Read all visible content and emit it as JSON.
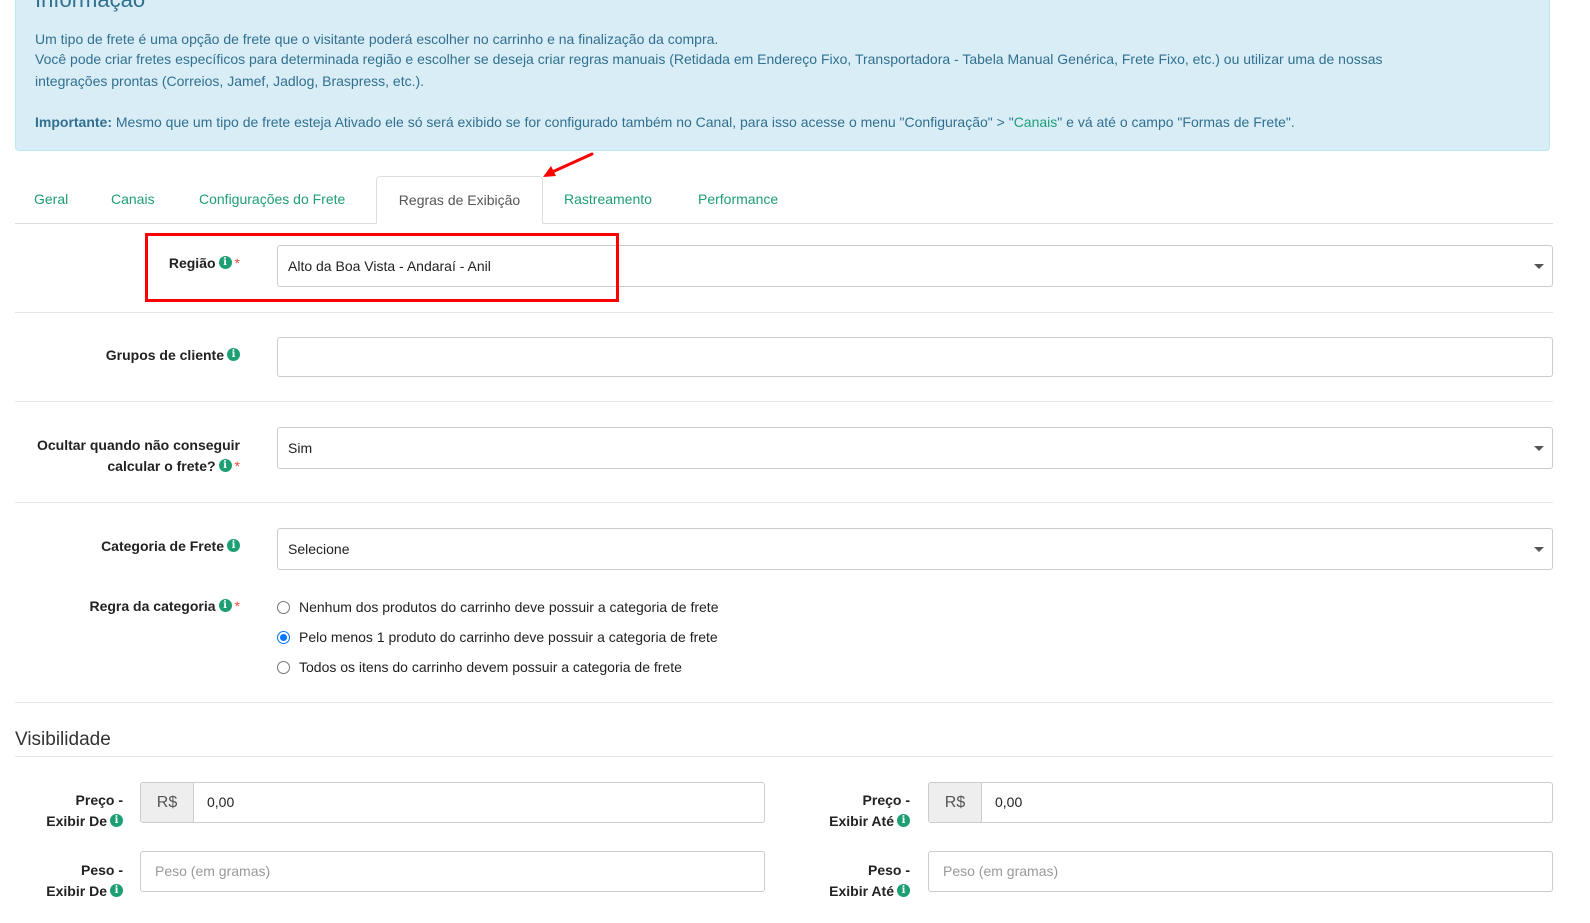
{
  "info": {
    "title": "Informação",
    "line1": "Um tipo de frete é uma opção de frete que o visitante poderá escolher no carrinho e na finalização da compra.",
    "line2": "Você pode criar fretes específicos para determinada região e escolher se deseja criar regras manuais (Retidada em Endereço Fixo, Transportadora - Tabela Manual Genérica, Frete Fixo, etc.) ou utilizar uma de nossas",
    "line3": "integrações prontas (Correios, Jamef, Jadlog, Braspress, etc.).",
    "important_label": "Importante:",
    "important_text_1": " Mesmo que um tipo de frete esteja Ativado ele só será exibido se for configurado também no Canal, para isso acesse o menu \"Configuração\" > \"",
    "important_link": "Canais",
    "important_text_2": "\" e vá até o campo \"Formas de Frete\"."
  },
  "tabs": [
    {
      "label": "Geral"
    },
    {
      "label": "Canais"
    },
    {
      "label": "Configurações do Frete"
    },
    {
      "label": "Regras de Exibição",
      "active": true
    },
    {
      "label": "Rastreamento"
    },
    {
      "label": "Performance"
    }
  ],
  "form": {
    "regiao": {
      "label": "Região",
      "value": "Alto da Boa Vista - Andaraí - Anil",
      "required": true
    },
    "grupos": {
      "label": "Grupos de cliente",
      "value": ""
    },
    "ocultar": {
      "label_line1": "Ocultar quando não conseguir",
      "label_line2": "calcular o frete?",
      "value": "Sim",
      "required": true
    },
    "categoria": {
      "label": "Categoria de Frete",
      "value": "Selecione"
    },
    "regra": {
      "label": "Regra da categoria",
      "required": true,
      "options": [
        {
          "label": "Nenhum dos produtos do carrinho deve possuir a categoria de frete",
          "checked": false
        },
        {
          "label": "Pelo menos 1 produto do carrinho deve possuir a categoria de frete",
          "checked": true
        },
        {
          "label": "Todos os itens do carrinho devem possuir a categoria de frete",
          "checked": false
        }
      ]
    }
  },
  "visibilidade": {
    "title": "Visibilidade",
    "preco_de": {
      "label_line1": "Preço -",
      "label_line2": "Exibir De",
      "addon": "R$",
      "value": "0,00"
    },
    "preco_ate": {
      "label_line1": "Preço -",
      "label_line2": "Exibir Até",
      "addon": "R$",
      "value": "0,00"
    },
    "peso_de": {
      "label_line1": "Peso -",
      "label_line2": "Exibir De",
      "placeholder": "Peso (em gramas)"
    },
    "peso_ate": {
      "label_line1": "Peso -",
      "label_line2": "Exibir Até",
      "placeholder": "Peso (em gramas)"
    }
  },
  "colors": {
    "accent": "#1e9e73",
    "info_bg": "#d9edf7",
    "info_text": "#31708f",
    "annotation": "#ff0000",
    "radio": "#0075ff"
  }
}
